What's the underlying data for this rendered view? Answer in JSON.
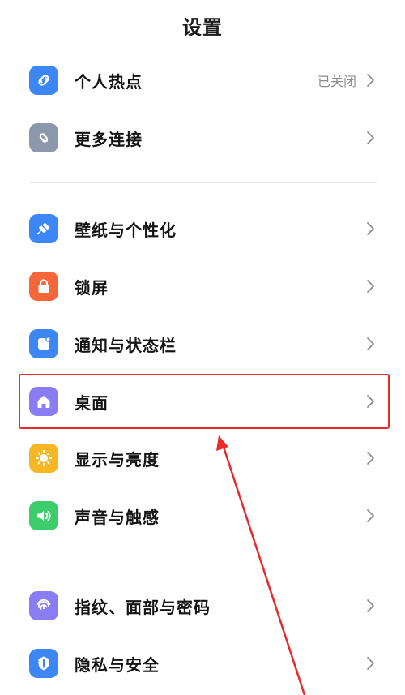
{
  "header": {
    "title": "设置"
  },
  "items": [
    {
      "label": "个人热点",
      "value": "已关闭",
      "icon": "hotspot-icon",
      "color": "#3d86f5"
    },
    {
      "label": "更多连接",
      "value": "",
      "icon": "link-icon",
      "color": "#8e98ad"
    },
    {
      "label": "壁纸与个性化",
      "value": "",
      "icon": "brush-icon",
      "color": "#3d86f5"
    },
    {
      "label": "锁屏",
      "value": "",
      "icon": "lock-icon",
      "color": "#f5663a"
    },
    {
      "label": "通知与状态栏",
      "value": "",
      "icon": "notification-icon",
      "color": "#3d86f5"
    },
    {
      "label": "桌面",
      "value": "",
      "icon": "home-icon",
      "color": "#8a7cf2"
    },
    {
      "label": "显示与亮度",
      "value": "",
      "icon": "sun-icon",
      "color": "#f7b623"
    },
    {
      "label": "声音与触感",
      "value": "",
      "icon": "speaker-icon",
      "color": "#3dcc6a"
    },
    {
      "label": "指纹、面部与密码",
      "value": "",
      "icon": "fingerprint-icon",
      "color": "#8a7cf2"
    },
    {
      "label": "隐私与安全",
      "value": "",
      "icon": "privacy-shield-icon",
      "color": "#3d86f5"
    }
  ],
  "annotation": {
    "highlight_color": "#e52b2b",
    "highlighted_item": "桌面"
  }
}
